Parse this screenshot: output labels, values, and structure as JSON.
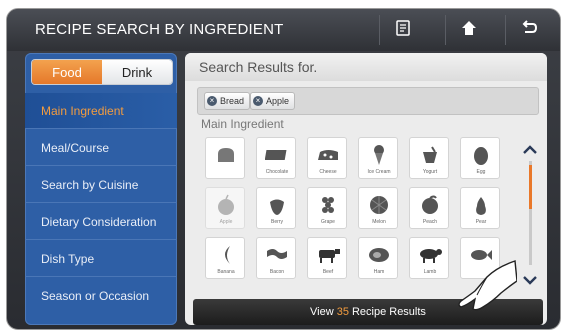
{
  "window": {
    "title": "RECIPE SEARCH BY INGREDIENT"
  },
  "toolbar": {
    "recipe_icon": "recipe-card-icon",
    "home_icon": "home-icon",
    "back_icon": "back-icon"
  },
  "sidebar": {
    "toggle": {
      "food": "Food",
      "drink": "Drink",
      "selected": "Food"
    },
    "items": [
      {
        "label": "Main Ingredient",
        "selected": true
      },
      {
        "label": "Meal/Course"
      },
      {
        "label": "Search by Cuisine"
      },
      {
        "label": "Dietary Consideration"
      },
      {
        "label": "Dish Type"
      },
      {
        "label": "Season or Occasion"
      }
    ]
  },
  "results": {
    "header": "Search Results for.",
    "tags": [
      {
        "label": "Bread"
      },
      {
        "label": "Apple"
      }
    ],
    "section_title": "Main Ingredient",
    "items": [
      {
        "label": "",
        "icon": "bread-icon"
      },
      {
        "label": "Chocolate",
        "icon": "chocolate-icon"
      },
      {
        "label": "Cheese",
        "icon": "cheese-icon"
      },
      {
        "label": "Ice Cream",
        "icon": "ice-cream-icon"
      },
      {
        "label": "Yogurt",
        "icon": "yogurt-icon"
      },
      {
        "label": "Egg",
        "icon": "egg-icon"
      },
      {
        "label": "Apple",
        "icon": "apple-icon"
      },
      {
        "label": "Berry",
        "icon": "berry-icon"
      },
      {
        "label": "Grape",
        "icon": "grape-icon"
      },
      {
        "label": "Melon",
        "icon": "melon-icon"
      },
      {
        "label": "Peach",
        "icon": "peach-icon"
      },
      {
        "label": "Pear",
        "icon": "pear-icon"
      },
      {
        "label": "Banana",
        "icon": "banana-icon"
      },
      {
        "label": "Bacon",
        "icon": "bacon-icon"
      },
      {
        "label": "Beef",
        "icon": "beef-icon"
      },
      {
        "label": "Ham",
        "icon": "ham-icon"
      },
      {
        "label": "Lamb",
        "icon": "lamb-icon"
      },
      {
        "label": "",
        "icon": "fish-icon"
      }
    ],
    "view_button": {
      "prefix": "View",
      "count": "35",
      "suffix": "Recipe Results"
    }
  },
  "colors": {
    "accent": "#f39c3f",
    "sidebar": "#2e5fa6",
    "topbar": "#3a3d43"
  }
}
